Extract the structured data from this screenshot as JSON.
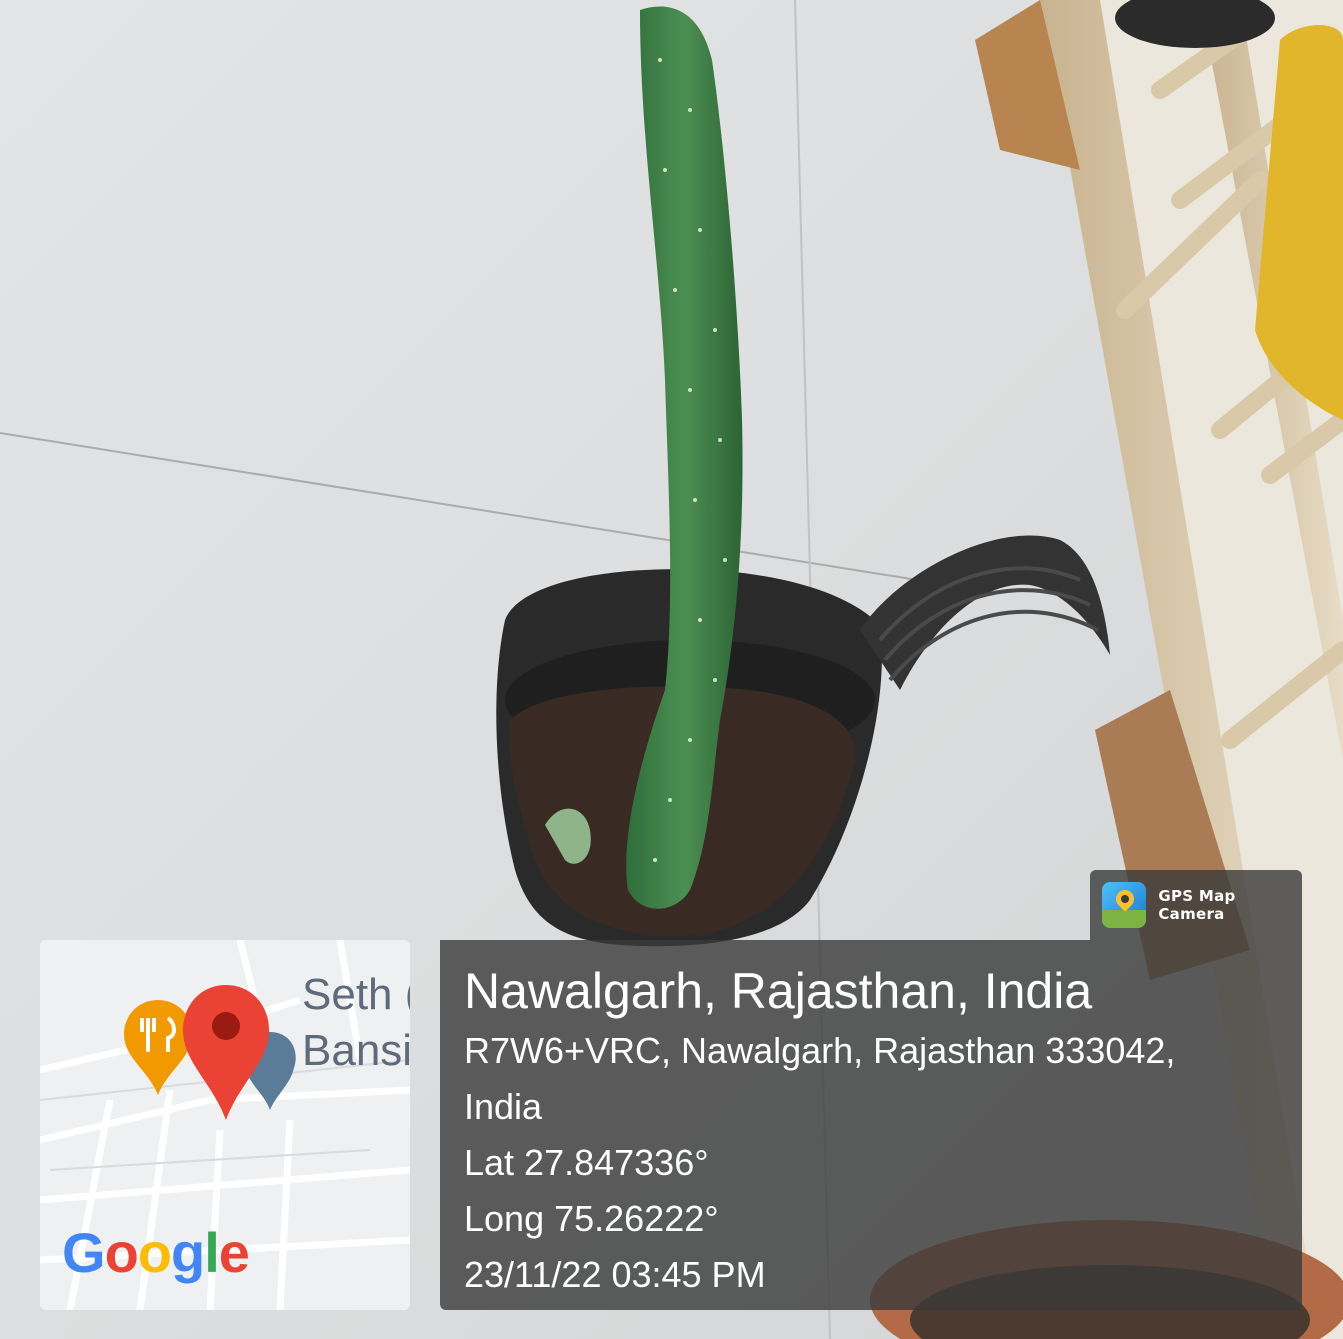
{
  "app_badge": {
    "icon": "gps-map-camera-icon",
    "name": "GPS Map Camera"
  },
  "map_tile": {
    "place_label_line1": "Seth (",
    "place_label_line2": "Bansi",
    "logo": "Google",
    "logo_colors": [
      "#4285F4",
      "#EA4335",
      "#FBBC05",
      "#4285F4",
      "#34A853",
      "#EA4335"
    ],
    "pin_color": "#EA4335",
    "restaurant_icon": "restaurant-pin-icon",
    "restaurant_color": "#F29900"
  },
  "location": {
    "title": "Nawalgarh, Rajasthan, India",
    "address_line1": "R7W6+VRC, Nawalgarh, Rajasthan 333042,",
    "address_line2": "India",
    "lat": "Lat 27.847336°",
    "long": "Long 75.26222°",
    "datetime": "23/11/22 03:45 PM"
  }
}
